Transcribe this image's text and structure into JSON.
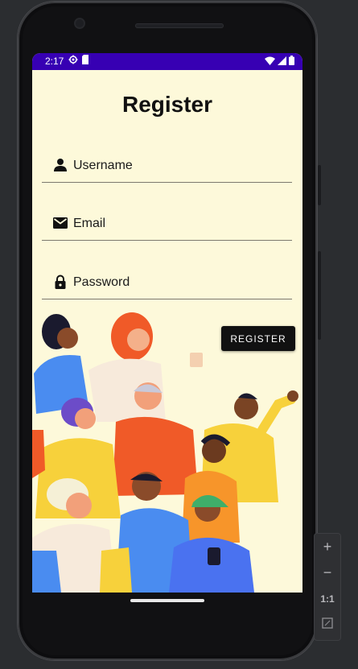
{
  "status_bar": {
    "time": "2:17",
    "left_icons": [
      "settings-icon",
      "sd-card-icon"
    ],
    "right_icons": [
      "wifi-icon",
      "signal-icon",
      "battery-icon"
    ],
    "color": "#3700b3"
  },
  "page": {
    "title": "Register",
    "background": "#fdf9da"
  },
  "form": {
    "username": {
      "label": "Username",
      "icon": "person-icon"
    },
    "email": {
      "label": "Email",
      "icon": "mail-icon"
    },
    "password": {
      "label": "Password",
      "icon": "lock-icon"
    },
    "register_label": "REGISTER"
  },
  "emulator_controls": {
    "zoom_in": "+",
    "zoom_out": "−",
    "actual_size": "1:1"
  }
}
